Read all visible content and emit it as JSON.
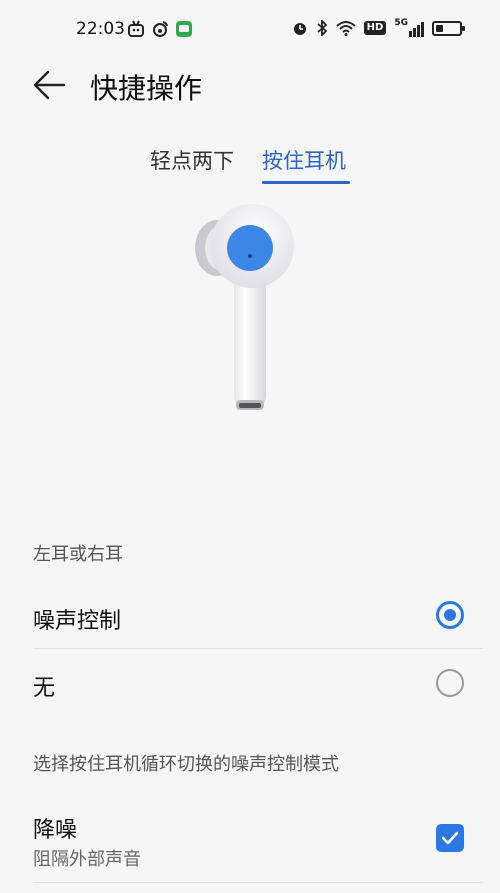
{
  "status_bar": {
    "time": "22:03",
    "left_icons": [
      "tv-app-icon",
      "weibo-icon",
      "message-app-icon"
    ],
    "right_icons": [
      "alarm-icon",
      "bluetooth-icon",
      "wifi-icon",
      "hd-icon",
      "signal-5g-icon",
      "battery-icon"
    ],
    "hd_label": "HD",
    "network_label": "5G"
  },
  "header": {
    "title": "快捷操作"
  },
  "tabs": [
    {
      "label": "轻点两下",
      "selected": false
    },
    {
      "label": "按住耳机",
      "selected": true
    }
  ],
  "illustration": {
    "name": "earbud-illustration",
    "highlight_color": "#3b87e6"
  },
  "ear_section": {
    "caption": "左耳或右耳",
    "options": [
      {
        "label": "噪声控制",
        "selected": true
      },
      {
        "label": "无",
        "selected": false
      }
    ]
  },
  "noise_section": {
    "caption": "选择按住耳机循环切换的噪声控制模式",
    "options": [
      {
        "label": "降噪",
        "description": "阻隔外部声音",
        "checked": true
      }
    ]
  },
  "colors": {
    "accent": "#2b78e4",
    "tab_active": "#2b64c8",
    "background": "#f6f6f6"
  }
}
